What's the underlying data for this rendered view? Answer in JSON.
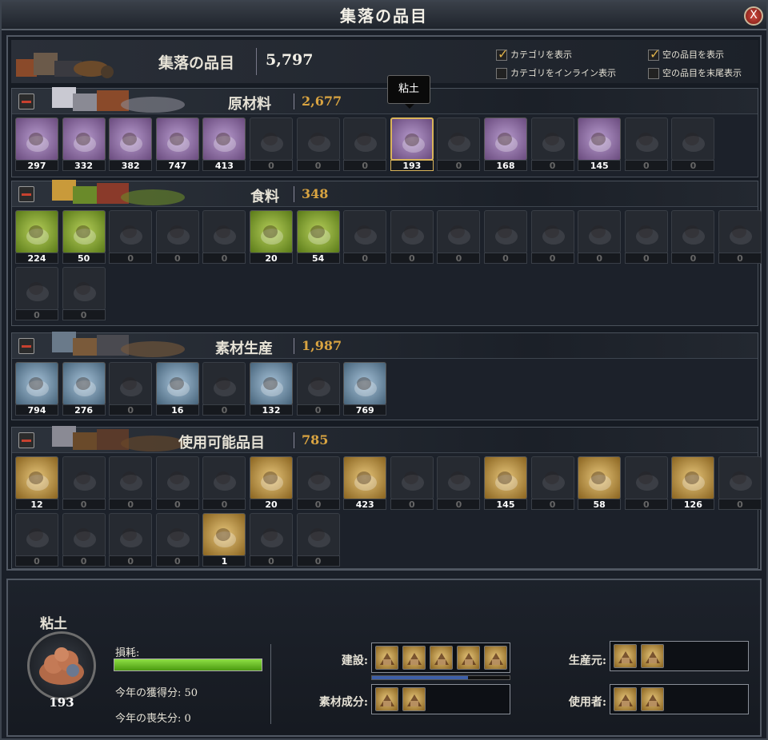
{
  "window": {
    "title": "集落の品目",
    "close_label": "X"
  },
  "summary": {
    "label": "集落の品目",
    "value": "5,797",
    "options": [
      {
        "label": "カテゴリを表示",
        "checked": true
      },
      {
        "label": "空の品目を表示",
        "checked": true
      },
      {
        "label": "カテゴリをインライン表示",
        "checked": false
      },
      {
        "label": "空の品目を末尾表示",
        "checked": false
      }
    ]
  },
  "tooltip": {
    "text": "粘土"
  },
  "categories": [
    {
      "name": "原材料",
      "total": "2,677",
      "kind": "raw",
      "items": [
        {
          "icon": "firewood-icon",
          "count": "297"
        },
        {
          "icon": "stone-icon",
          "count": "332"
        },
        {
          "icon": "wheat-icon",
          "count": "382"
        },
        {
          "icon": "water-bucket-icon",
          "count": "747"
        },
        {
          "icon": "iron-ore-icon",
          "count": "413"
        },
        {
          "icon": "nuts-icon",
          "count": "0"
        },
        {
          "icon": "coal-icon",
          "count": "0"
        },
        {
          "icon": "herbs-icon",
          "count": "0"
        },
        {
          "icon": "clay-icon",
          "count": "193",
          "selected": true
        },
        {
          "icon": "roots-icon",
          "count": "0"
        },
        {
          "icon": "grapes-icon",
          "count": "168"
        },
        {
          "icon": "barrel-icon",
          "count": "0"
        },
        {
          "icon": "straw-bundle-icon",
          "count": "145"
        },
        {
          "icon": "honeycomb-icon",
          "count": "0"
        },
        {
          "icon": "sand-icon",
          "count": "0"
        }
      ]
    },
    {
      "name": "食料",
      "total": "348",
      "kind": "food",
      "items": [
        {
          "icon": "berries-icon",
          "count": "224"
        },
        {
          "icon": "meat-icon",
          "count": "50"
        },
        {
          "icon": "vegetables-icon",
          "count": "0"
        },
        {
          "icon": "bread-icon",
          "count": "0"
        },
        {
          "icon": "fish-icon",
          "count": "0"
        },
        {
          "icon": "ham-icon",
          "count": "20"
        },
        {
          "icon": "dried-fish-icon",
          "count": "54"
        },
        {
          "icon": "mushrooms-icon",
          "count": "0"
        },
        {
          "icon": "apples-icon",
          "count": "0"
        },
        {
          "icon": "jam-icon",
          "count": "0"
        },
        {
          "icon": "potatoes-icon",
          "count": "0"
        },
        {
          "icon": "eggs-icon",
          "count": "0"
        },
        {
          "icon": "beans-icon",
          "count": "0"
        },
        {
          "icon": "porridge-icon",
          "count": "0"
        },
        {
          "icon": "cheese-icon",
          "count": "0"
        },
        {
          "icon": "spirits-icon",
          "count": "0"
        },
        {
          "icon": "cabbage-icon",
          "count": "0"
        },
        {
          "icon": "preserves-jar-icon",
          "count": "0"
        }
      ]
    },
    {
      "name": "素材生産",
      "total": "1,987",
      "kind": "mat",
      "items": [
        {
          "icon": "logs-icon",
          "count": "794"
        },
        {
          "icon": "planks-icon",
          "count": "276"
        },
        {
          "icon": "leather-icon",
          "count": "0"
        },
        {
          "icon": "hide-icon",
          "count": "16"
        },
        {
          "icon": "iron-ingot-icon",
          "count": "0"
        },
        {
          "icon": "stone-block-icon",
          "count": "132"
        },
        {
          "icon": "brick-icon",
          "count": "0"
        },
        {
          "icon": "gold-ingot-icon",
          "count": "769"
        }
      ]
    },
    {
      "name": "使用可能品目",
      "total": "785",
      "kind": "use",
      "items": [
        {
          "icon": "coat-icon",
          "count": "12"
        },
        {
          "icon": "crossbow-icon",
          "count": "0"
        },
        {
          "icon": "sword-icon",
          "count": "0"
        },
        {
          "icon": "axe-icon",
          "count": "0"
        },
        {
          "icon": "mace-icon",
          "count": "0"
        },
        {
          "icon": "bow-icon",
          "count": "20"
        },
        {
          "icon": "spear-icon",
          "count": "0"
        },
        {
          "icon": "arrows-icon",
          "count": "423"
        },
        {
          "icon": "boots-icon",
          "count": "0"
        },
        {
          "icon": "tunic-icon",
          "count": "0"
        },
        {
          "icon": "pottery-icon",
          "count": "145"
        },
        {
          "icon": "mug-icon",
          "count": "0"
        },
        {
          "icon": "basket-icon",
          "count": "58"
        },
        {
          "icon": "chair-icon",
          "count": "0"
        },
        {
          "icon": "soap-icon",
          "count": "126"
        },
        {
          "icon": "candles-icon",
          "count": "0"
        },
        {
          "icon": "spices-icon",
          "count": "0"
        },
        {
          "icon": "flask-icon",
          "count": "0"
        },
        {
          "icon": "cask-icon",
          "count": "0"
        },
        {
          "icon": "shield-icon",
          "count": "0"
        },
        {
          "icon": "saw-blade-icon",
          "count": "1"
        },
        {
          "icon": "chainmail-icon",
          "count": "0"
        },
        {
          "icon": "armor-icon",
          "count": "0"
        }
      ]
    }
  ],
  "detail": {
    "name": "粘土",
    "count": "193",
    "wear_label": "損耗:",
    "wear_fraction": 1.0,
    "gain_text": "今年の獲得分: 50",
    "loss_text": "今年の喪失分: 0",
    "build_label": "建設:",
    "material_label": "素材成分:",
    "producer_label": "生産元:",
    "user_label": "使用者:",
    "build_icons": [
      "cottage-icon",
      "storehouse-icon",
      "longhouse-icon",
      "granary-icon",
      "garden-icon"
    ],
    "material_icons": [
      "clay-brick-icon",
      "pottery-icon"
    ],
    "producer_icons": [
      "clay-pit-icon",
      "pit-house-icon"
    ],
    "user_icons": [
      "kiln-icon",
      "workshop-icon"
    ],
    "build_progress": 0.7
  },
  "colors": {
    "accent": "#d9a441",
    "wear_bar": "#6cc22a",
    "raw_bg": "#8d6aa4",
    "food_bg": "#7f9e2a",
    "mat_bg": "#6b89a3",
    "use_bg": "#b98f3a"
  }
}
